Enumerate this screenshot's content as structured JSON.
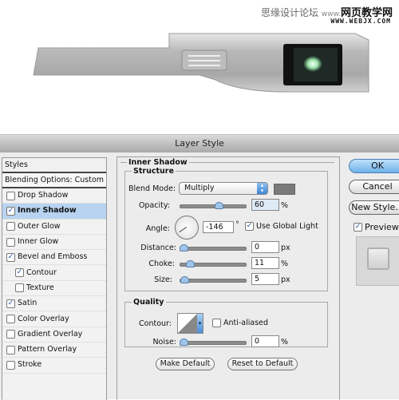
{
  "watermark": {
    "site_name_cn": "思缘设计论坛",
    "site_prefix": "www.",
    "site_name2_cn": "网页教学网",
    "url": "WWW.WEBJX.COM"
  },
  "dialog": {
    "title": "Layer Style",
    "sidebar": {
      "header": "Styles",
      "blending_options": "Blending Options: Custom",
      "items": [
        {
          "label": "Drop Shadow",
          "checked": false,
          "selected": false,
          "indent": false
        },
        {
          "label": "Inner Shadow",
          "checked": true,
          "selected": true,
          "indent": false
        },
        {
          "label": "Outer Glow",
          "checked": false,
          "selected": false,
          "indent": false
        },
        {
          "label": "Inner Glow",
          "checked": false,
          "selected": false,
          "indent": false
        },
        {
          "label": "Bevel and Emboss",
          "checked": true,
          "selected": false,
          "indent": false
        },
        {
          "label": "Contour",
          "checked": true,
          "selected": false,
          "indent": true
        },
        {
          "label": "Texture",
          "checked": false,
          "selected": false,
          "indent": true
        },
        {
          "label": "Satin",
          "checked": true,
          "selected": false,
          "indent": false
        },
        {
          "label": "Color Overlay",
          "checked": false,
          "selected": false,
          "indent": false
        },
        {
          "label": "Gradient Overlay",
          "checked": false,
          "selected": false,
          "indent": false
        },
        {
          "label": "Pattern Overlay",
          "checked": false,
          "selected": false,
          "indent": false
        },
        {
          "label": "Stroke",
          "checked": false,
          "selected": false,
          "indent": false
        }
      ]
    },
    "panel": {
      "section_title": "Inner Shadow",
      "structure": {
        "title": "Structure",
        "blend_mode_label": "Blend Mode:",
        "blend_mode_value": "Multiply",
        "shadow_color": "#7a7a7a",
        "opacity_label": "Opacity:",
        "opacity_value": "60",
        "opacity_unit": "%",
        "opacity_fraction": 0.6,
        "angle_label": "Angle:",
        "angle_value": "-146",
        "angle_unit": "°",
        "use_global_light_label": "Use Global Light",
        "use_global_light": true,
        "distance_label": "Distance:",
        "distance_value": "0",
        "distance_unit": "px",
        "distance_fraction": 0.0,
        "choke_label": "Choke:",
        "choke_value": "11",
        "choke_unit": "%",
        "choke_fraction": 0.11,
        "size_label": "Size:",
        "size_value": "5",
        "size_unit": "px",
        "size_fraction": 0.02
      },
      "quality": {
        "title": "Quality",
        "contour_label": "Contour:",
        "anti_aliased_label": "Anti-aliased",
        "anti_aliased": false,
        "noise_label": "Noise:",
        "noise_value": "0",
        "noise_unit": "%",
        "noise_fraction": 0.0
      },
      "make_default_label": "Make Default",
      "reset_default_label": "Reset to Default"
    },
    "buttons": {
      "ok": "OK",
      "cancel": "Cancel",
      "new_style": "New Style...",
      "preview_label": "Preview",
      "preview_checked": true
    }
  }
}
